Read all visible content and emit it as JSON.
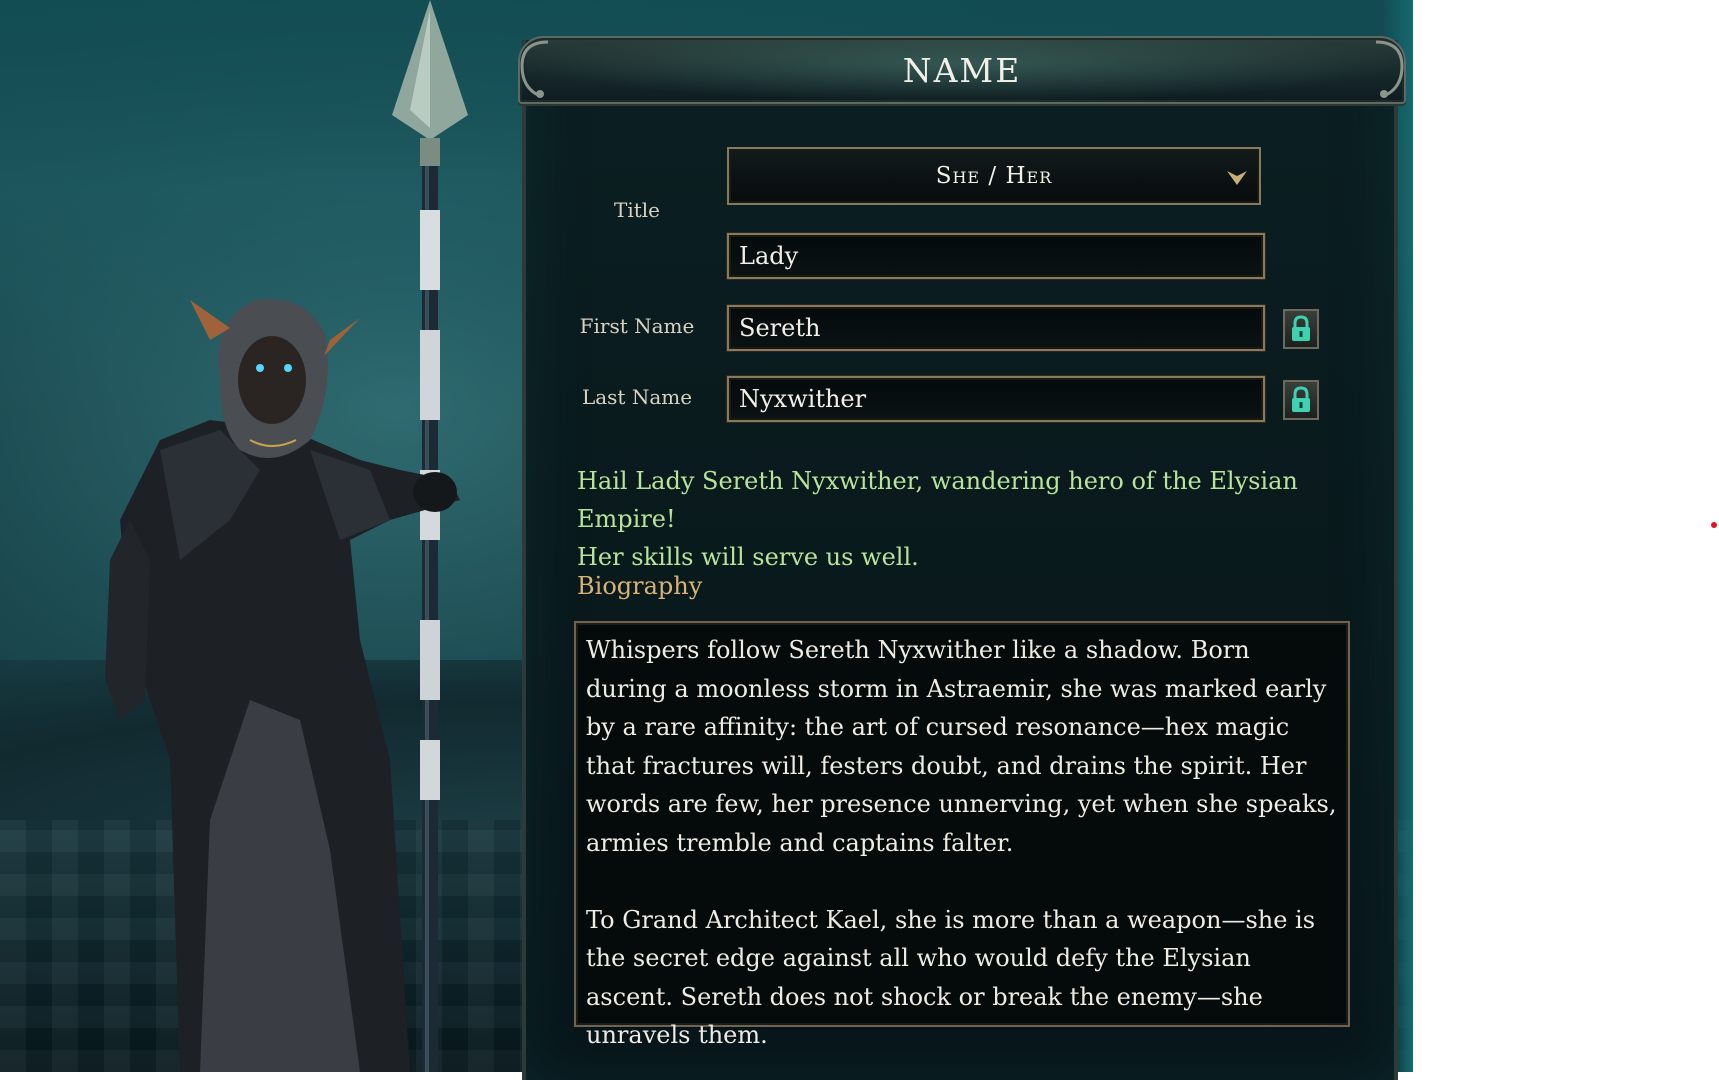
{
  "header": {
    "title": "NAME"
  },
  "form": {
    "title_label": "Title",
    "pronoun_dropdown": {
      "selected": "She / Her"
    },
    "title_value": "Lady",
    "first_name_label": "First Name",
    "first_name_value": "Sereth",
    "last_name_label": "Last Name",
    "last_name_value": "Nyxwither"
  },
  "greeting": {
    "line1": "Hail Lady Sereth Nyxwither, wandering hero of the Elysian Empire!",
    "line2": "Her skills will serve us well."
  },
  "biography": {
    "heading": "Biography",
    "paragraph1": "Whispers follow Sereth Nyxwither like a shadow. Born during a moonless storm in Astraemir, she was marked early by a rare affinity: the art of cursed resonance—hex magic that fractures will, festers doubt, and drains the spirit. Her words are few, her presence unnerving, yet when she speaks, armies tremble and captains falter.",
    "paragraph2": "To Grand Architect Kael, she is more than a weapon—she is the secret edge against all who would defy the Elysian ascent. Sereth does not shock or break the enemy—she unravels them."
  },
  "colors": {
    "greeting_text": "#b7e39b",
    "biography_heading": "#d9b277",
    "field_border": "#8a7a5c",
    "lock_icon": "#3fd2b0"
  },
  "icons": {
    "dropdown": "chevron-down-icon",
    "first_name_lock": "lock-icon",
    "last_name_lock": "lock-icon"
  }
}
